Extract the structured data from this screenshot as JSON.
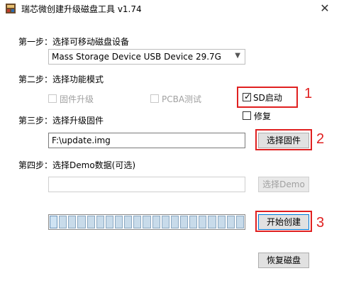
{
  "window": {
    "title": "瑞芯微创建升级磁盘工具 v1.74",
    "close_glyph": "✕"
  },
  "step1": {
    "label": "第一步：选择可移动磁盘设备",
    "device_selected": "Mass Storage Device USB Device   29.7G"
  },
  "step2": {
    "label": "第二步：选择功能模式",
    "options": {
      "firmware_upgrade": {
        "label": "固件升级",
        "checked": false,
        "enabled": false
      },
      "pcba_test": {
        "label": "PCBA测试",
        "checked": false,
        "enabled": false
      },
      "sd_boot": {
        "label": "SD启动",
        "checked": true,
        "enabled": true
      },
      "repair": {
        "label": "修复",
        "checked": false,
        "enabled": true
      }
    }
  },
  "step3": {
    "label": "第三步：选择升级固件",
    "firmware_path": "F:\\update.img",
    "select_button": "选择固件"
  },
  "step4": {
    "label": "第四步：选择Demo数据(可选)",
    "demo_path": "",
    "select_button": "选择Demo"
  },
  "actions": {
    "start_button": "开始创建",
    "restore_button": "恢复磁盘"
  },
  "progress": {
    "segments": 21,
    "value": 0.0
  },
  "annotations": {
    "n1": "1",
    "n2": "2",
    "n3": "3",
    "color": "#e02020"
  }
}
